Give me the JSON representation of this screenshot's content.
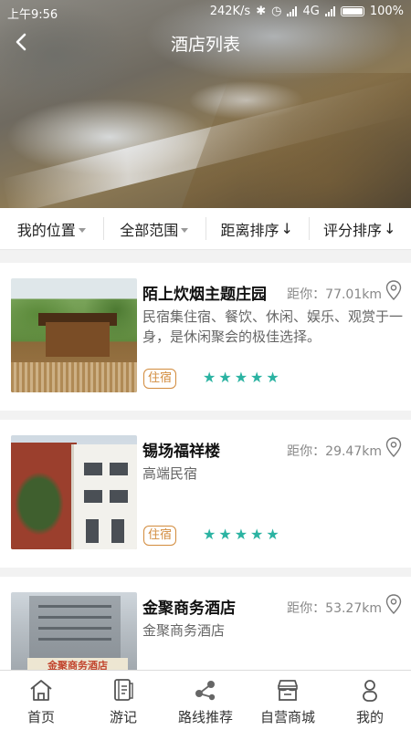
{
  "status_bar": {
    "time": "上午9:56",
    "speed": "242K/s",
    "network": "4G",
    "battery": "100%"
  },
  "header": {
    "title": "酒店列表"
  },
  "filters": [
    {
      "label": "我的位置",
      "indicator": "caret-down"
    },
    {
      "label": "全部范围",
      "indicator": "caret-down"
    },
    {
      "label": "距离排序",
      "indicator": "↓"
    },
    {
      "label": "评分排序",
      "indicator": "↓"
    }
  ],
  "hotels": [
    {
      "name": "陌上炊烟主题庄园",
      "distance": "距你：77.01km",
      "description": "民宿集住宿、餐饮、休闲、娱乐、观赏于一身，是休闲聚会的极佳选择。",
      "tag": "住宿",
      "rating": 5
    },
    {
      "name": "锡场福祥楼",
      "distance": "距你：29.47km",
      "description": "高端民宿",
      "tag": "住宿",
      "rating": 5
    },
    {
      "name": "金聚商务酒店",
      "distance": "距你：53.27km",
      "description": "金聚商务酒店",
      "tag": "",
      "rating": 0
    }
  ],
  "thumb3_sign": "金聚商务酒店",
  "bottom_nav": [
    {
      "label": "首页",
      "icon": "home-icon"
    },
    {
      "label": "游记",
      "icon": "notes-icon"
    },
    {
      "label": "路线推荐",
      "icon": "route-icon"
    },
    {
      "label": "自营商城",
      "icon": "store-icon"
    },
    {
      "label": "我的",
      "icon": "profile-icon"
    }
  ],
  "colors": {
    "accent_star": "#2bb3a2",
    "tag_border": "#d28b3c"
  }
}
